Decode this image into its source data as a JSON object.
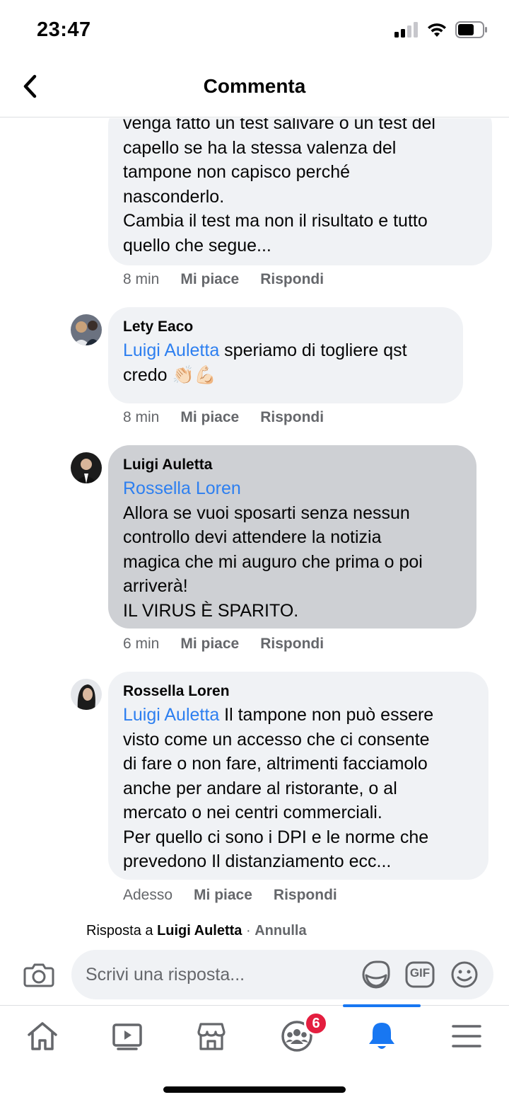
{
  "status_bar": {
    "time": "23:47"
  },
  "header": {
    "title": "Commenta"
  },
  "comments": [
    {
      "author": "",
      "mention": "",
      "text": "venga fatto un test salivare o un test del\ncapello se ha la stessa valenza del\ntampone non capisco perché\nnasconderlo.\nCambia il test ma non il risultato e tutto\nquello che segue...",
      "time": "8 min",
      "like": "Mi piace",
      "reply": "Rispondi"
    },
    {
      "author": "Lety Eaco",
      "mention": "Luigi Auletta",
      "text": " speriamo di togliere qst\ncredo 👏🏻💪🏻",
      "time": "8 min",
      "like": "Mi piace",
      "reply": "Rispondi"
    },
    {
      "author": "Luigi Auletta",
      "mention": "Rossella Loren",
      "text": "\nAllora se vuoi sposarti senza nessun\ncontrollo devi attendere la notizia\nmagica che mi auguro che prima o poi\narriverà!\nIL VIRUS È SPARITO.",
      "time": "6 min",
      "like": "Mi piace",
      "reply": "Rispondi"
    },
    {
      "author": "Rossella Loren",
      "mention": "Luigi Auletta",
      "text": " Il tampone non può essere\nvisto come un accesso che ci consente\ndi fare o non fare, altrimenti facciamolo\nanche per andare al ristorante, o al\nmercato o nei centri commerciali.\nPer quello ci sono i DPI e le norme che\nprevedono Il distanziamento ecc...",
      "time": "Adesso",
      "like": "Mi piace",
      "reply": "Rispondi"
    }
  ],
  "reply_banner": {
    "prefix": "Risposta a",
    "name": "Luigi Auletta",
    "separator": "·",
    "cancel": "Annulla"
  },
  "composer": {
    "placeholder": "Scrivi una risposta...",
    "gif_label": "GIF"
  },
  "bottom_nav": {
    "groups_badge": "6",
    "active_tab": "notifications",
    "accent_color": "#1877f2"
  },
  "colors": {
    "mention": "#2d7ff0",
    "bubble": "#f0f2f5",
    "bubble_highlight": "#ced0d4",
    "badge": "#e41e3f"
  }
}
